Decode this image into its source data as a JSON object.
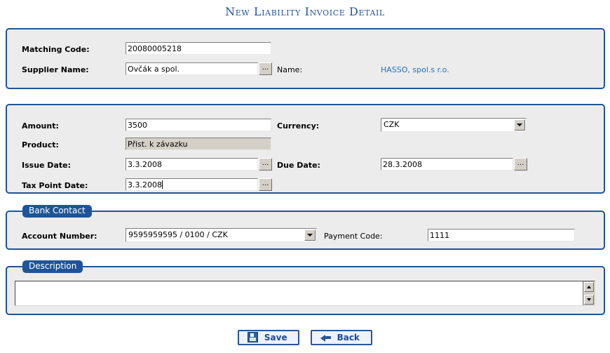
{
  "page": {
    "title": "New Liability Invoice Detail",
    "accent_blue": "#1f5596",
    "title_blue": "#21559b",
    "link_blue": "#1d6fc6",
    "panel_bg": "#ececec",
    "readonly_bg": "#d4d0c8"
  },
  "panel_supplier": {
    "matching_code_label": "Matching Code:",
    "matching_code_value": "20080005218",
    "supplier_name_label": "Supplier Name:",
    "supplier_name_value": "Ovčák a spol.",
    "supplier_browse_label": "...",
    "name_label": "Name:",
    "name_value": "HASSO, spol.s r.o."
  },
  "panel_invoice": {
    "amount_label": "Amount:",
    "amount_value": "3500",
    "currency_label": "Currency:",
    "currency_value": "CZK",
    "product_label": "Product:",
    "product_value": "Přist. k závazku",
    "issue_date_label": "Issue Date:",
    "issue_date_value": "3.3.2008",
    "issue_date_browse_label": "...",
    "due_date_label": "Due Date:",
    "due_date_value": "28.3.2008",
    "due_date_browse_label": "...",
    "tax_point_date_label": "Tax Point Date:",
    "tax_point_date_value": "3.3.2008",
    "tax_point_date_browse_label": "..."
  },
  "panel_bank": {
    "legend": "Bank Contact",
    "account_number_label": "Account Number:",
    "account_number_value": "9595959595 / 0100 / CZK",
    "payment_code_label": "Payment Code:",
    "payment_code_value": "1111"
  },
  "panel_description": {
    "legend": "Description",
    "text_value": ""
  },
  "footer": {
    "save_label": "Save",
    "save_icon": "floppy-disk-icon",
    "back_label": "Back",
    "back_icon": "arrow-left-icon"
  }
}
